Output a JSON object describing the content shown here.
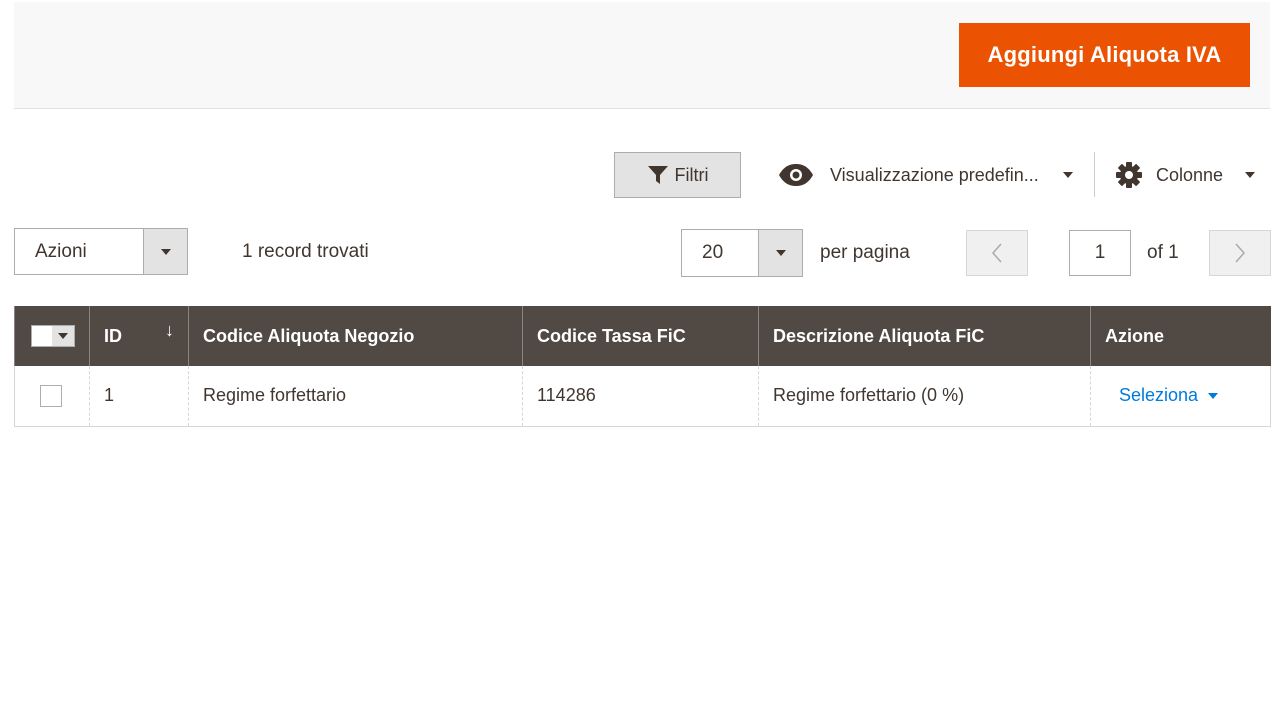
{
  "header": {
    "add_button": "Aggiungi Aliquota IVA"
  },
  "toolbar": {
    "filters": "Filtri",
    "view": "Visualizzazione predefin...",
    "columns": "Colonne"
  },
  "actions": {
    "select": "Azioni",
    "records_found": "1 record trovati"
  },
  "pagination": {
    "per_page_value": "20",
    "per_page_label": "per pagina",
    "current_page": "1",
    "total_pages_label": "of 1"
  },
  "table": {
    "headers": [
      "ID",
      "Codice Aliquota Negozio",
      "Codice Tassa FiC",
      "Descrizione Aliquota FiC",
      "Azione"
    ],
    "rows": [
      {
        "id": "1",
        "store_code": "Regime forfettario",
        "tax_code": "114286",
        "description": "Regime forfettario (0 %)",
        "action": "Seleziona"
      }
    ]
  },
  "colors": {
    "accent": "#eb5202",
    "header_bg": "#514943",
    "link": "#007bdb"
  }
}
